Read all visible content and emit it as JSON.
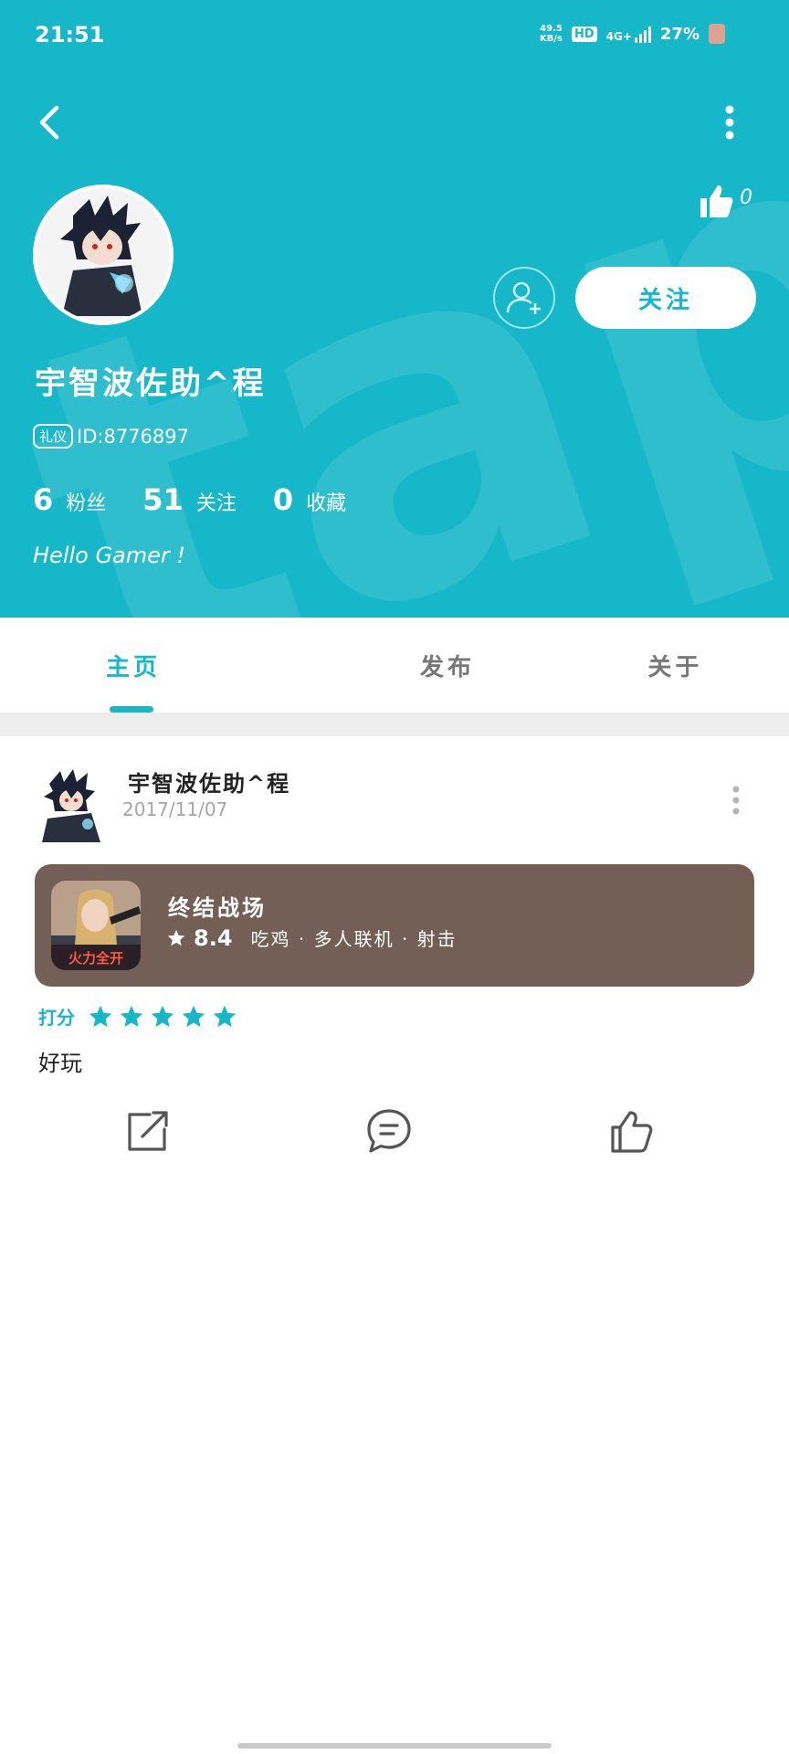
{
  "status_bar": {
    "time": "21:51",
    "net_speed_value": "49.5",
    "net_speed_unit": "KB/s",
    "hd": "HD",
    "network": "4G+",
    "battery": "27%"
  },
  "profile": {
    "username": "宇智波佐助^程",
    "id_badge": "礼仪",
    "id_text": "ID:8776897",
    "likes_count": "0",
    "follow_label": "关注",
    "stats": [
      {
        "num": "6",
        "label": "粉丝"
      },
      {
        "num": "51",
        "label": "关注"
      },
      {
        "num": "0",
        "label": "收藏"
      }
    ],
    "bio": "Hello Gamer !"
  },
  "tabs": [
    {
      "label": "主页",
      "active": true
    },
    {
      "label": "发布",
      "active": false
    },
    {
      "label": "关于",
      "active": false
    }
  ],
  "post": {
    "author": "宇智波佐助^程",
    "date": "2017/11/07",
    "game": {
      "title": "终结战场",
      "score": "8.4",
      "tags": "吃鸡 · 多人联机 · 射击",
      "icon_caption": "火力全开"
    },
    "rating_label": "打分",
    "rating_stars": 5,
    "review_text": "好玩"
  },
  "colors": {
    "accent": "#15b7c8",
    "game_card": "#735f55"
  }
}
